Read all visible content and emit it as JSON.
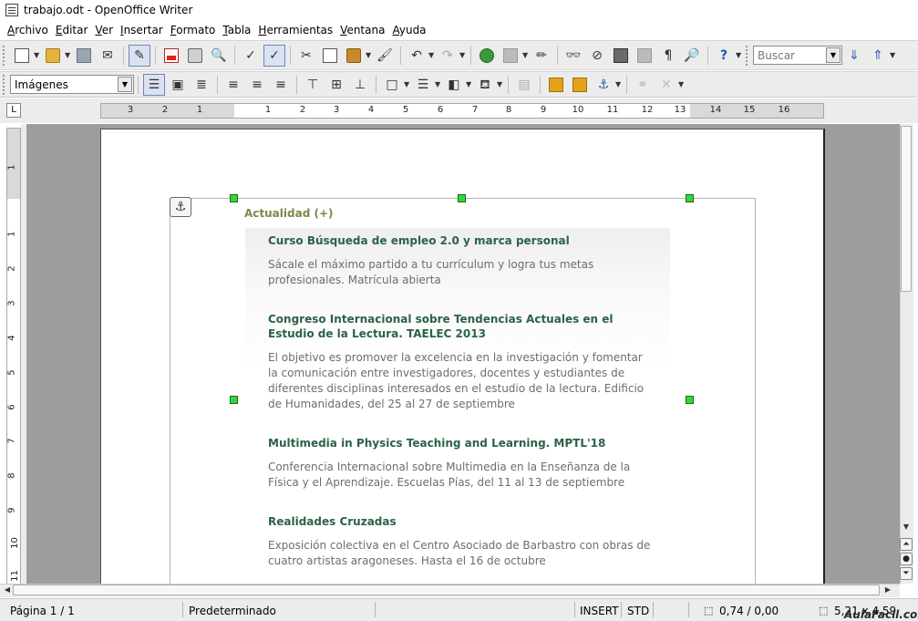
{
  "window": {
    "title": "trabajo.odt - OpenOffice Writer"
  },
  "menu": [
    "Archivo",
    "Editar",
    "Ver",
    "Insertar",
    "Formato",
    "Tabla",
    "Herramientas",
    "Ventana",
    "Ayuda"
  ],
  "toolbar": {
    "search_placeholder": "Buscar",
    "style_value": "Imágenes"
  },
  "rulers": {
    "horizontal_ticks": [
      "3",
      "2",
      "1",
      "1",
      "2",
      "3",
      "4",
      "5",
      "6",
      "7",
      "8",
      "9",
      "10",
      "11",
      "12",
      "13",
      "14",
      "15",
      "16"
    ],
    "vertical_ticks": [
      "1",
      "1",
      "2",
      "3",
      "4",
      "5",
      "6",
      "7",
      "8",
      "9",
      "10",
      "11"
    ]
  },
  "document": {
    "section_title": "Actualidad (+)",
    "items": [
      {
        "title": "Curso Búsqueda de empleo 2.0 y marca personal",
        "desc": "Sácale el máximo partido a tu currículum y logra tus metas profesionales. Matrícula abierta"
      },
      {
        "title": "Congreso Internacional sobre Tendencias Actuales en el Estudio de la Lectura. TAELEC 2013",
        "desc": "El objetivo es promover la excelencia en la investigación y fomentar la comunicación entre investigadores, docentes y estudiantes de diferentes disciplinas interesados en el estudio de la lectura. Edificio de Humanidades, del 25 al 27 de septiembre"
      },
      {
        "title": "Multimedia in Physics Teaching and Learning. MPTL'18",
        "desc": "Conferencia Internacional sobre Multimedia en la Enseñanza de la Física y el Aprendizaje. Escuelas Pías, del 11 al 13 de septiembre"
      },
      {
        "title": "Realidades Cruzadas",
        "desc": "Exposición colectiva en el Centro Asociado de Barbastro con obras de cuatro artistas aragoneses. Hasta el 16 de octubre"
      }
    ]
  },
  "status": {
    "page": "Página 1 / 1",
    "style": "Predeterminado",
    "mode": "INSERT",
    "selection": "STD",
    "position": "0,74 / 0,00",
    "size": "5,21 x 4,59"
  },
  "watermark": "AulaFacil.com",
  "colors": {
    "section_title": "#7a8a48",
    "news_title": "#2c6246",
    "news_desc": "#6d6d6d",
    "handle": "#35d63a"
  }
}
